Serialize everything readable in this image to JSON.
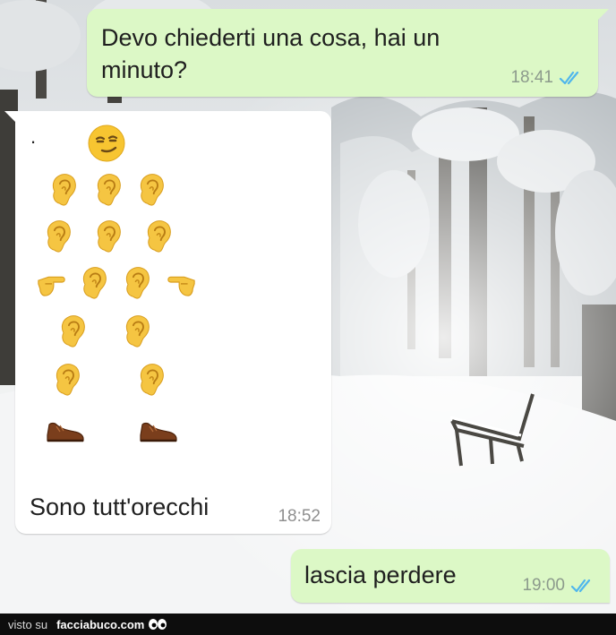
{
  "messages": [
    {
      "id": "outgoing-1",
      "direction": "outgoing",
      "text": "Devo chiederti una cosa, hai un minuto?",
      "time": "18:41",
      "status": "read"
    },
    {
      "id": "incoming-1",
      "direction": "incoming",
      "dot": ".",
      "emoji_art": {
        "top": "smirking-face",
        "rows": [
          [
            "ear",
            "ear",
            "ear"
          ],
          [
            "ear",
            "ear",
            "ear"
          ],
          [
            "backhand-index-pointing-right",
            "ear",
            "ear",
            "backhand-index-pointing-left"
          ],
          [
            "ear",
            "ear"
          ],
          [
            "ear",
            "ear"
          ],
          [
            "mans-shoe",
            "mans-shoe"
          ]
        ]
      },
      "text": "Sono tutt'orecchi",
      "time": "18:52"
    },
    {
      "id": "outgoing-2",
      "direction": "outgoing",
      "text": "lascia perdere",
      "time": "19:00",
      "status": "read"
    }
  ],
  "footer": {
    "prefix": "visto su",
    "brand": "facciabuco.com",
    "logo_icon": "eyes-icon"
  },
  "colors": {
    "outgoing_bubble": "#dcf8c6",
    "incoming_bubble": "#ffffff",
    "read_ticks": "#4fb6ec",
    "footer_bg": "#0d0d0d"
  }
}
